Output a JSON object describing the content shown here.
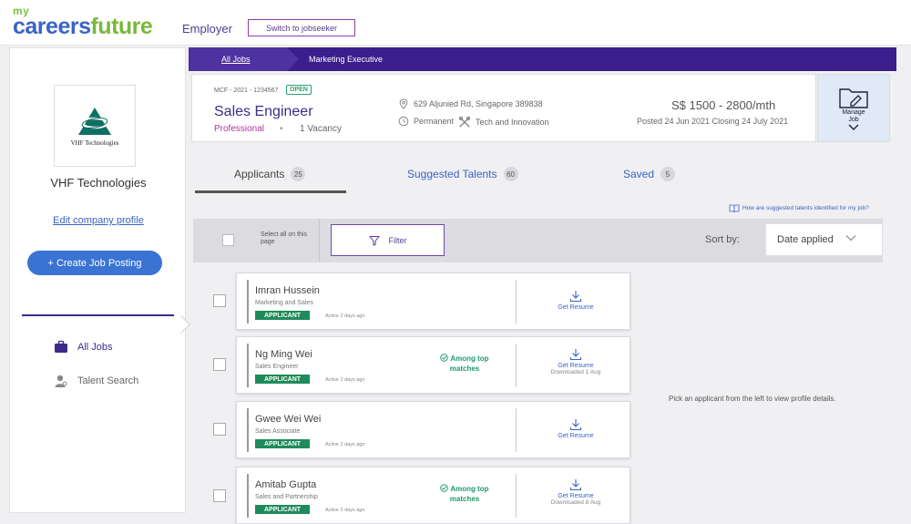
{
  "header": {
    "logo_my": "my",
    "logo_careers": "careers",
    "logo_future": "future",
    "portal": "Employer",
    "switch_label": "Switch to jobseeker"
  },
  "sidebar": {
    "company_logo_text": "VHF Technologies",
    "company_name": "VHF Technologies",
    "edit_profile": "Edit company profile",
    "create_job": "+ Create Job Posting",
    "nav": [
      {
        "label": "All Jobs",
        "icon": "briefcase-icon"
      },
      {
        "label": "Talent Search",
        "icon": "person-icon"
      }
    ]
  },
  "breadcrumb": {
    "all_jobs": "All Jobs",
    "current": "Marketing Executive"
  },
  "job": {
    "id": "MCF - 2021 - 1234567",
    "status": "OPEN",
    "title": "Sales Engineer",
    "level": "Professional",
    "separator": "•",
    "vacancy": "1 Vacancy",
    "address": "629 Aljunied Rd, Singapore 389838",
    "employment": "Permanent",
    "industry": "Tech and Innovation",
    "salary": "S$ 1500 - 2800/mth",
    "posted": "Posted 24 Jun 2021 Closing 24 July 2021",
    "manage": "Manage Job"
  },
  "tabs": [
    {
      "label": "Applicants",
      "count": "25",
      "color": "#444444"
    },
    {
      "label": "Suggested Talents",
      "count": "60",
      "color": "#3a63c4"
    },
    {
      "label": "Saved",
      "count": "5",
      "color": "#3a63c4"
    }
  ],
  "help_link": "How are suggested talents identified for my job?",
  "filterbar": {
    "select_all": "Select all on this page",
    "filter": "Filter",
    "sort_by": "Sort by:",
    "sort_value": "Date applied"
  },
  "applicants": [
    {
      "name": "Imran Hussein",
      "role": "Marketing and Sales",
      "badge": "APPLICANT",
      "active": "Active 2 days ago",
      "match": "",
      "resume": "Get Resume",
      "downloaded": ""
    },
    {
      "name": "Ng Ming Wei",
      "role": "Sales Engineer",
      "badge": "APPLICANT",
      "active": "Active 2 days ago",
      "match": "Among top matches",
      "resume": "Get Resume",
      "downloaded": "Downloaded 1 Aug"
    },
    {
      "name": "Gwee Wei Wei",
      "role": "Sales Associate",
      "badge": "APPLICANT",
      "active": "Active 2 days ago",
      "match": "",
      "resume": "Get Resume",
      "downloaded": ""
    },
    {
      "name": "Amitab Gupta",
      "role": "Sales and Partnership",
      "badge": "APPLICANT",
      "active": "Active 2 days ago",
      "match": "Among top matches",
      "resume": "Get Resume",
      "downloaded": "Downloaded 8 Aug"
    }
  ],
  "detail_placeholder": "Pick an applicant from the left to view profile details."
}
